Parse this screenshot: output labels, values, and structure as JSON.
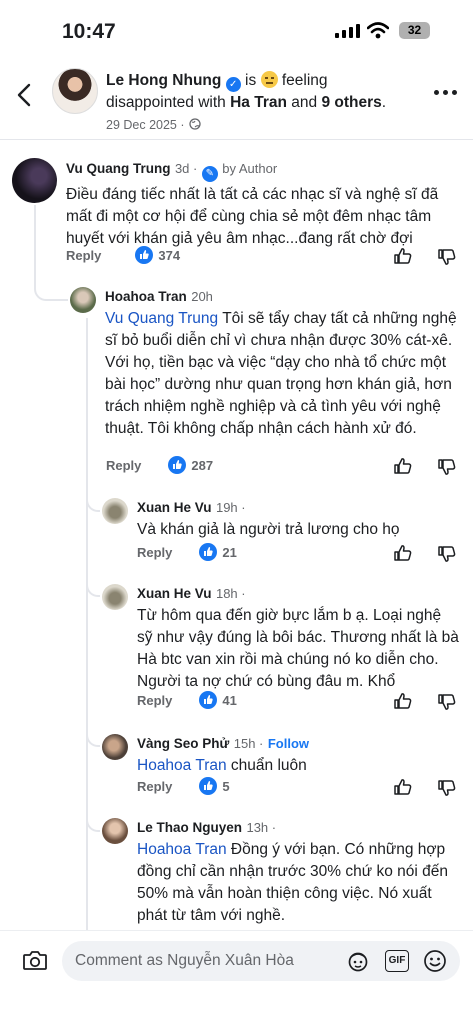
{
  "status": {
    "time": "10:47",
    "battery": "32"
  },
  "post": {
    "author": "Le Hong Nhung",
    "is": "is",
    "feeling": "feeling disappointed with",
    "with_name": "Ha Tran",
    "and": "and",
    "others": "9 others",
    "date": "29 Dec 2025 ·"
  },
  "comments": [
    {
      "name": "Vu Quang Trung",
      "time": "3d ·",
      "badge": "by Author",
      "text": "Điều đáng tiếc nhất là tất cả các nhạc sĩ và nghệ sĩ đã mất đi một cơ hội để cùng chia sẻ một đêm nhạc tâm huyết với khán giả yêu âm nhạc...đang rất chờ đợi",
      "reply": "Reply",
      "likes": "374"
    },
    {
      "name": "Hoahoa Tran",
      "time": "20h",
      "mention": "Vu Quang Trung",
      "text": " Tôi sẽ tẩy chay tất cả những nghệ sĩ bỏ buổi diễn chỉ vì chưa nhận được 30% cát-xê. Với họ, tiền bạc và việc “dạy cho nhà tổ chức một bài học” dường như quan trọng hơn khán giả, hơn trách nhiệm nghề nghiệp và cả tình yêu với nghệ thuật. Tôi không chấp nhận cách hành xử đó.",
      "reply": "Reply",
      "likes": "287"
    },
    {
      "name": "Xuan He Vu",
      "time": "19h ·",
      "text": "Và khán giả là người trả lương cho họ",
      "reply": "Reply",
      "likes": "21"
    },
    {
      "name": "Xuan He Vu",
      "time": "18h ·",
      "text": "Từ hôm qua đến giờ bực lắm b ạ. Loại nghệ sỹ như vậy đúng là bôi bác. Thương nhất là bà Hà btc van xin rồi mà chúng nó ko diễn cho. Người ta nợ chứ có bùng đâu m. Khổ",
      "reply": "Reply",
      "likes": "41"
    },
    {
      "name": "Vàng Seo Phử",
      "time": "15h ·",
      "follow": "Follow",
      "mention": "Hoahoa Tran",
      "text": " chuẩn luôn",
      "reply": "Reply",
      "likes": "5"
    },
    {
      "name": "Le Thao Nguyen",
      "time": "13h ·",
      "mention": "Hoahoa Tran",
      "text": " Đồng ý với bạn. Có những hợp đồng chỉ cần nhận trước 30% chứ ko nói đến 50% mà vẫn hoàn thiện công việc. Nó xuất phát từ tâm với nghề."
    }
  ],
  "composer": {
    "placeholder": "Comment as Nguyễn Xuân Hòa",
    "gif": "GIF"
  },
  "colors": {
    "accent": "#1877f2",
    "mention": "#1a55c4",
    "muted": "#65676b"
  },
  "icons": [
    "back-arrow-icon",
    "verified-icon",
    "disappointed-emoji-icon",
    "globe-icon",
    "more-icon",
    "like-icon",
    "dislike-icon",
    "camera-icon",
    "avatar-sticker-icon",
    "gif-icon",
    "emoji-icon"
  ]
}
